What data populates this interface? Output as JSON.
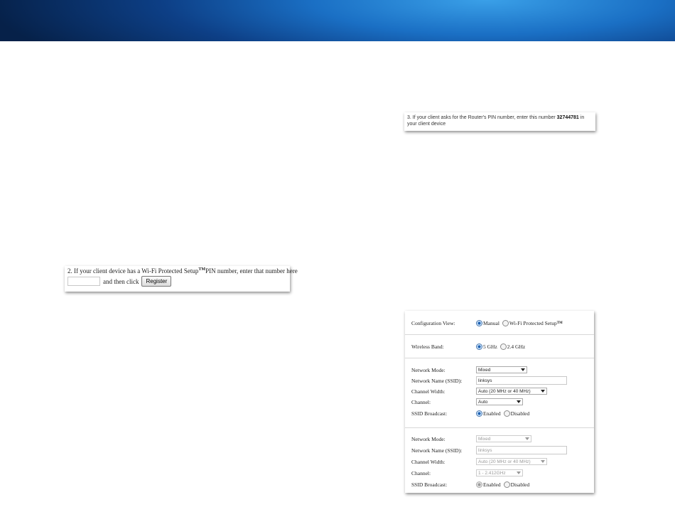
{
  "wps_pin_panel": {
    "text_before": "2. If your client device has a Wi-Fi Protected Setup",
    "tm": "TM",
    "text_after": "PIN number, enter that number here",
    "pin_input_value": "",
    "then_click": "and then click",
    "register_label": "Register"
  },
  "router_pin_panel": {
    "text_before": "3. If your client asks for the Router's PIN number, enter this number ",
    "pin": "32744781",
    "text_after": " in your client device"
  },
  "settings": {
    "configuration_view": {
      "label": "Configuration View:",
      "options": [
        "Manual",
        "Wi-Fi Protected Setup"
      ],
      "tm": "TM",
      "selected": "Manual"
    },
    "wireless_band": {
      "label": "Wireless Band:",
      "options": [
        "5 GHz",
        "2.4 GHz"
      ],
      "selected": "5 GHz"
    },
    "band_5ghz": {
      "network_mode_label": "Network Mode:",
      "network_mode_value": "Mixed",
      "ssid_label": "Network Name (SSID):",
      "ssid_value": "linksys",
      "channel_width_label": "Channel Width:",
      "channel_width_value": "Auto (20 MHz or 40 MHz)",
      "channel_label": "Channel:",
      "channel_value": "Auto",
      "ssid_broadcast_label": "SSID Broadcast:",
      "ssid_broadcast_options": [
        "Enabled",
        "Disabled"
      ],
      "ssid_broadcast_selected": "Enabled"
    },
    "band_24ghz": {
      "network_mode_label": "Network Mode:",
      "network_mode_value": "Mixed",
      "ssid_label": "Network Name (SSID):",
      "ssid_value": "linksys",
      "channel_width_label": "Channel Width:",
      "channel_width_value": "Auto (20 MHz or 40 MHz)",
      "channel_label": "Channel:",
      "channel_value": "1 - 2.412GHz",
      "ssid_broadcast_label": "SSID Broadcast:",
      "ssid_broadcast_options": [
        "Enabled",
        "Disabled"
      ],
      "ssid_broadcast_selected": "Enabled"
    }
  },
  "colors": {
    "banner_light": "#3aa0e8",
    "banner_dark": "#062149",
    "radio_selected": "#1e5fb0"
  }
}
